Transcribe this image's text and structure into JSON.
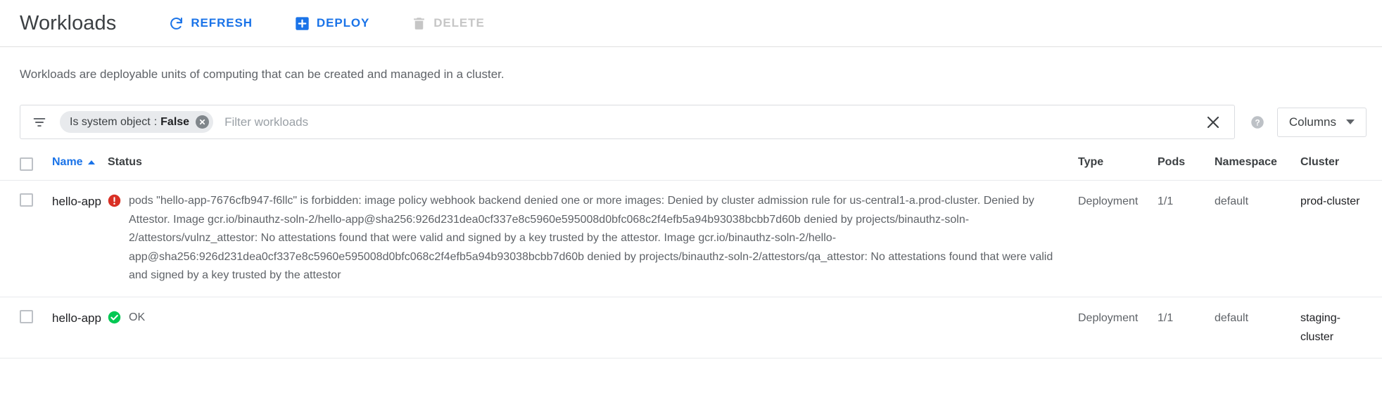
{
  "header": {
    "title": "Workloads",
    "actions": [
      {
        "label": "REFRESH",
        "icon": "refresh-icon",
        "disabled": false
      },
      {
        "label": "DEPLOY",
        "icon": "add-box-icon",
        "disabled": false
      },
      {
        "label": "DELETE",
        "icon": "trash-icon",
        "disabled": true
      }
    ]
  },
  "description": "Workloads are deployable units of computing that can be created and managed in a cluster.",
  "filter": {
    "icon": "filter-list-icon",
    "chip": {
      "key": "Is system object",
      "separator": ":",
      "value": "False",
      "remove_icon": "chip-remove-icon"
    },
    "placeholder": "Filter workloads",
    "input_value": "",
    "clear_icon": "clear-icon",
    "help_icon": "help-icon",
    "columns_button": "Columns"
  },
  "table": {
    "columns": [
      {
        "key": "name",
        "label": "Name",
        "sorted": true,
        "sort_dir": "asc"
      },
      {
        "key": "status",
        "label": "Status"
      },
      {
        "key": "type",
        "label": "Type"
      },
      {
        "key": "pods",
        "label": "Pods"
      },
      {
        "key": "namespace",
        "label": "Namespace"
      },
      {
        "key": "cluster",
        "label": "Cluster"
      }
    ],
    "rows": [
      {
        "selected": false,
        "name": "hello-app",
        "status_icon": "error-icon",
        "status_color": "#d93025",
        "status": "pods \"hello-app-7676cfb947-f6llc\" is forbidden: image policy webhook backend denied one or more images: Denied by cluster admission rule for us-central1-a.prod-cluster. Denied by Attestor. Image gcr.io/binauthz-soln-2/hello-app@sha256:926d231dea0cf337e8c5960e595008d0bfc068c2f4efb5a94b93038bcbb7d60b denied by projects/binauthz-soln-2/attestors/vulnz_attestor: No attestations found that were valid and signed by a key trusted by the attestor. Image gcr.io/binauthz-soln-2/hello-app@sha256:926d231dea0cf337e8c5960e595008d0bfc068c2f4efb5a94b93038bcbb7d60b denied by projects/binauthz-soln-2/attestors/qa_attestor: No attestations found that were valid and signed by a key trusted by the attestor",
        "type": "Deployment",
        "pods": "1/1",
        "namespace": "default",
        "cluster": "prod-cluster"
      },
      {
        "selected": false,
        "name": "hello-app",
        "status_icon": "check-circle-icon",
        "status_color": "#00c853",
        "status": "OK",
        "type": "Deployment",
        "pods": "1/1",
        "namespace": "default",
        "cluster": "staging-cluster"
      }
    ]
  },
  "colors": {
    "accent_blue": "#1a73e8",
    "error_red": "#d93025",
    "ok_green": "#00c853",
    "text_primary": "#202124",
    "text_secondary": "#5f6368",
    "border": "#e0e0e0"
  }
}
